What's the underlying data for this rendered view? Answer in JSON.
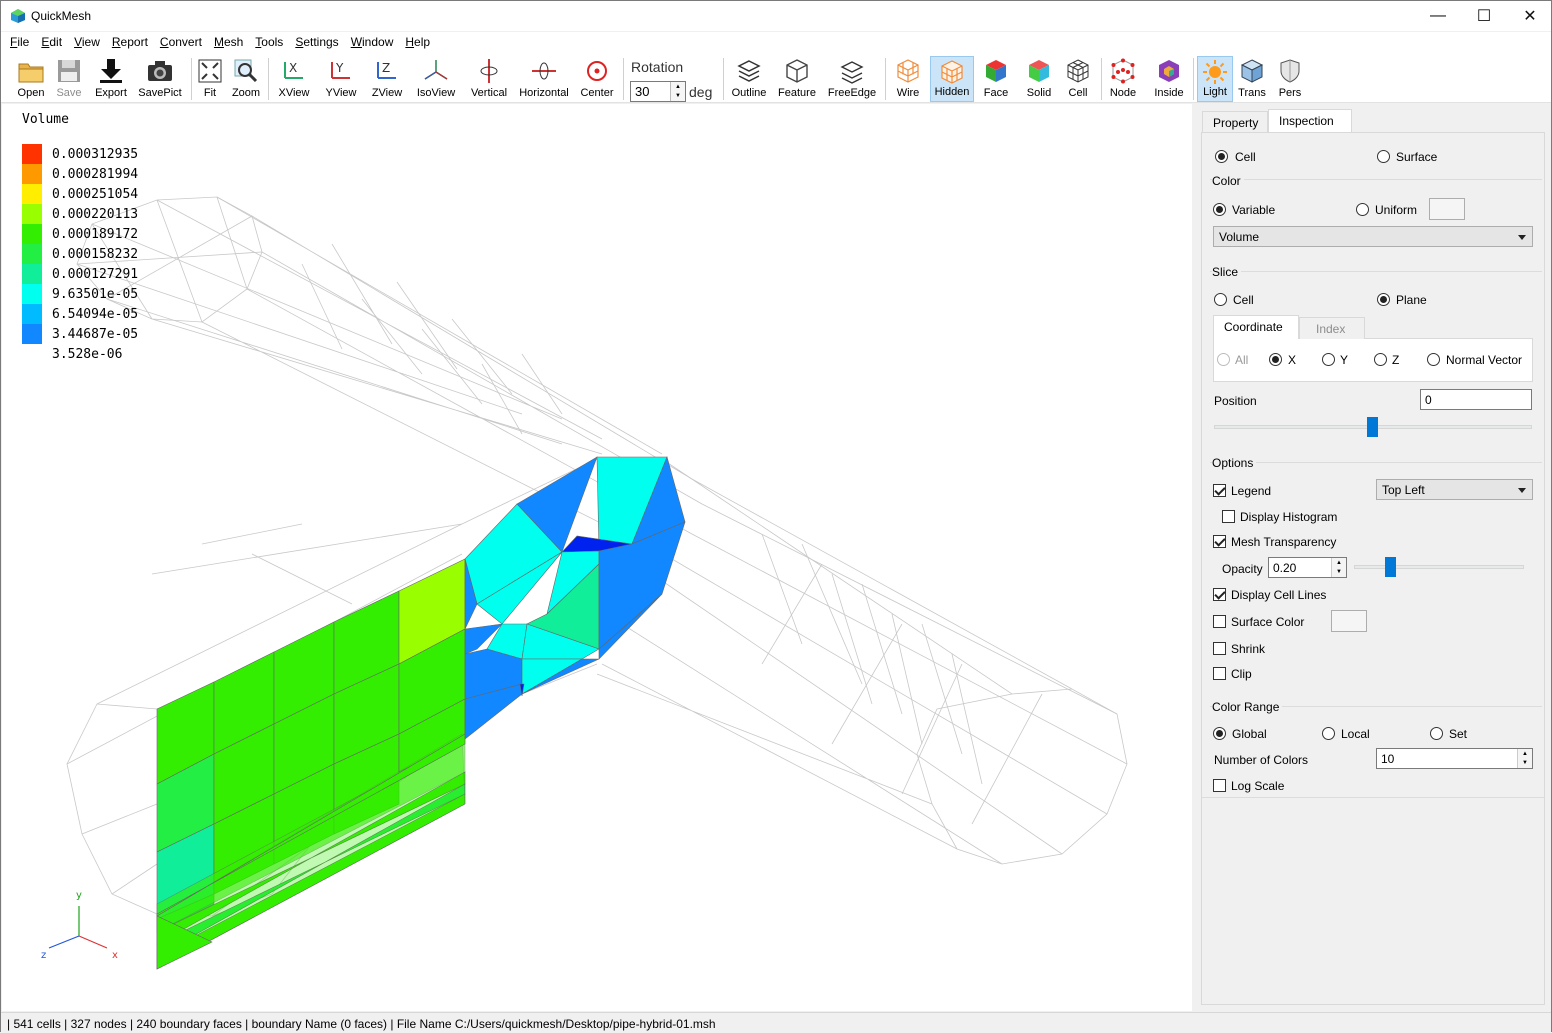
{
  "window": {
    "title": "QuickMesh",
    "minimize": "—",
    "maximize": "☐",
    "close": "✕"
  },
  "menu": {
    "items": [
      {
        "pre": "",
        "ul": "F",
        "post": "ile"
      },
      {
        "pre": "",
        "ul": "E",
        "post": "dit"
      },
      {
        "pre": "",
        "ul": "V",
        "post": "iew"
      },
      {
        "pre": "",
        "ul": "R",
        "post": "eport"
      },
      {
        "pre": "",
        "ul": "C",
        "post": "onvert"
      },
      {
        "pre": "",
        "ul": "M",
        "post": "esh"
      },
      {
        "pre": "",
        "ul": "T",
        "post": "ools"
      },
      {
        "pre": "",
        "ul": "S",
        "post": "ettings"
      },
      {
        "pre": "",
        "ul": "W",
        "post": "indow"
      },
      {
        "pre": "",
        "ul": "H",
        "post": "elp"
      }
    ]
  },
  "toolbar": {
    "open": "Open",
    "save": "Save",
    "export": "Export",
    "savepict": "SavePict",
    "fit": "Fit",
    "zoom": "Zoom",
    "xview": "XView",
    "yview": "YView",
    "zview": "ZView",
    "isoview": "IsoView",
    "vertical": "Vertical",
    "horizontal": "Horizontal",
    "center": "Center",
    "rotation_label": "Rotation",
    "rotation_value": "30",
    "rotation_unit": "deg",
    "outline": "Outline",
    "feature": "Feature",
    "freeedge": "FreeEdge",
    "wire": "Wire",
    "hidden": "Hidden",
    "face": "Face",
    "solid": "Solid",
    "cell": "Cell",
    "node": "Node",
    "inside": "Inside",
    "light": "Light",
    "trans": "Trans",
    "pers": "Pers"
  },
  "legend": {
    "title": "Volume",
    "entries": [
      {
        "value": "0.000312935",
        "color": "#ff3300"
      },
      {
        "value": "0.000281994",
        "color": "#ff9900"
      },
      {
        "value": "0.000251054",
        "color": "#ffee00"
      },
      {
        "value": "0.000220113",
        "color": "#99ff00"
      },
      {
        "value": "0.000189172",
        "color": "#33ee00"
      },
      {
        "value": "0.000158232",
        "color": "#22ee44"
      },
      {
        "value": "0.000127291",
        "color": "#11ee99"
      },
      {
        "value": "9.63501e-05",
        "color": "#00ffee"
      },
      {
        "value": "6.54094e-05",
        "color": "#00bbff"
      },
      {
        "value": "3.44687e-05",
        "color": "#1188ff"
      },
      {
        "value": "3.528e-06",
        "color": "#0022ee"
      }
    ]
  },
  "axes": {
    "x": "x",
    "y": "y",
    "z": "z"
  },
  "status": "| 541 cells | 327 nodes | 240 boundary faces |  boundary Name  (0 faces) | File Name C:/Users/quickmesh/Desktop/pipe-hybrid-01.msh",
  "panel": {
    "tabs": [
      "Property",
      "Inspection"
    ],
    "target_cell": "Cell",
    "target_surface": "Surface",
    "color_section": "Color",
    "color_variable": "Variable",
    "color_uniform": "Uniform",
    "variable_select": "Volume",
    "slice_section": "Slice",
    "slice_cell": "Cell",
    "slice_plane": "Plane",
    "slice_tabs": [
      "Coordinate",
      "Index"
    ],
    "axis_all": "All",
    "axis_x": "X",
    "axis_y": "Y",
    "axis_z": "Z",
    "axis_normal": "Normal Vector",
    "position_label": "Position",
    "position_value": "0",
    "options_section": "Options",
    "legend_label": "Legend",
    "legend_position": "Top Left",
    "display_histogram": "Display Histogram",
    "mesh_transparency": "Mesh Transparency",
    "opacity_label": "Opacity",
    "opacity_value": "0.20",
    "display_cell_lines": "Display Cell Lines",
    "surface_color": "Surface Color",
    "shrink": "Shrink",
    "clip": "Clip",
    "color_range_section": "Color Range",
    "range_global": "Global",
    "range_local": "Local",
    "range_set": "Set",
    "number_of_colors_label": "Number of Colors",
    "number_of_colors_value": "10",
    "log_scale": "Log Scale"
  }
}
